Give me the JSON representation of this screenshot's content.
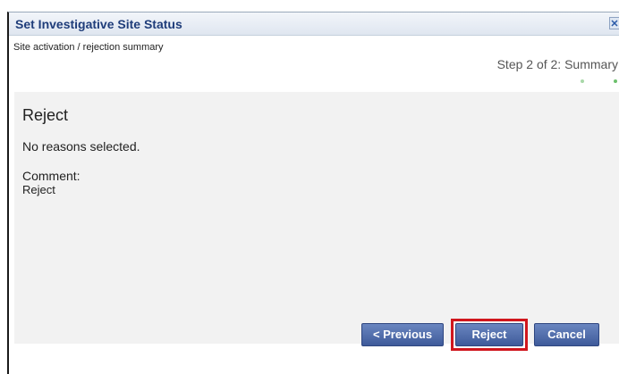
{
  "dialog": {
    "title": "Set Investigative Site Status",
    "close_icon": "close-icon",
    "subtitle": "Site activation / rejection summary",
    "step_label": "Step 2 of 2: Summary"
  },
  "summary": {
    "heading": "Reject",
    "reasons_text": "No reasons selected.",
    "comment_label": "Comment:",
    "comment_value": "Reject"
  },
  "buttons": {
    "previous": "< Previous",
    "reject": "Reject",
    "cancel": "Cancel"
  },
  "colors": {
    "title_text": "#1f3d7a",
    "button_fill": "#4a66a8",
    "highlight_border": "#d0161d",
    "step_dot_active": "#6cc06c"
  }
}
